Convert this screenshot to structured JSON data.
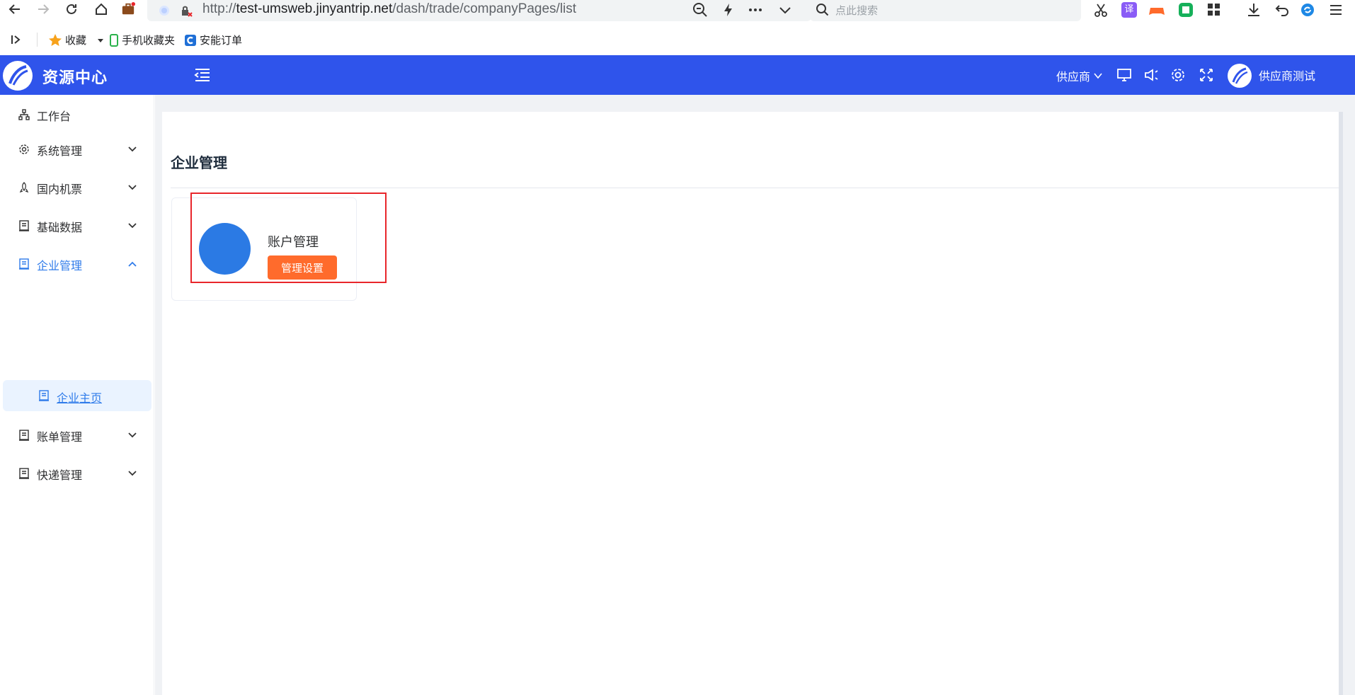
{
  "browser": {
    "url_prefix": "http://",
    "url_host": "test-umsweb.jinyantrip.net",
    "url_path": "/dash/trade/companyPages/list",
    "search_placeholder": "点此搜索",
    "translate_badge": "译",
    "bookmarks": [
      {
        "label": "收藏"
      },
      {
        "label": "手机收藏夹"
      },
      {
        "label": "安能订单"
      }
    ]
  },
  "header": {
    "app_title": "资源中心",
    "role_label": "供应商",
    "user_name": "供应商测试",
    "bg_color": "#2f54eb"
  },
  "sidebar": {
    "items": [
      {
        "label": "工作台",
        "icon": "sitemap-icon"
      },
      {
        "label": "系统管理",
        "icon": "gear-icon"
      },
      {
        "label": "国内机票",
        "icon": "rocket-icon"
      },
      {
        "label": "基础数据",
        "icon": "doc-icon"
      },
      {
        "label": "企业管理",
        "icon": "doc-icon",
        "expanded": true
      },
      {
        "label": "账单管理",
        "icon": "doc-icon"
      },
      {
        "label": "快递管理",
        "icon": "doc-icon"
      }
    ],
    "subitem": {
      "label": "企业主页",
      "icon": "doc-icon"
    },
    "active_color": "#2f7bea"
  },
  "main": {
    "page_title": "企业管理",
    "card": {
      "title": "账户管理",
      "button_label": "管理设置",
      "button_color": "#ff6b2c",
      "circle_color": "#2b7ae4"
    },
    "highlight_color": "#e8262b"
  }
}
